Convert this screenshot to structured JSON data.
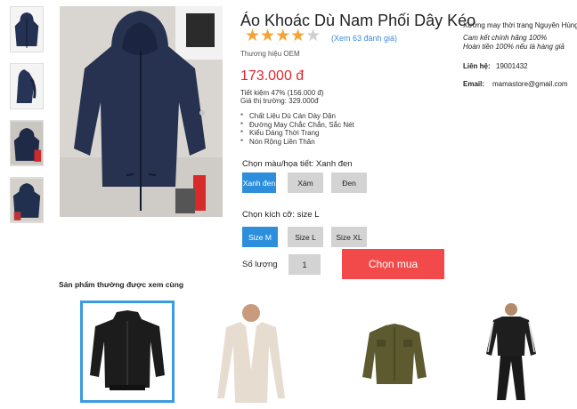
{
  "product": {
    "title": "Áo Khoác Dù Nam Phối Dây Kéo",
    "rating": 4,
    "rating_max": 5,
    "review_link": "(Xem 63 đánh giá)",
    "brand": "Thương hiệu OEM",
    "price": "173.000 đ",
    "saving": "Tiết kiệm 47% (156.000 đ)",
    "market_price": "Giá thị trường: 329.000đ",
    "features": [
      "Chất Liệu Dù Cán Dày Dặn",
      "Đường May Chắc Chắn, Sắc Nét",
      "Kiểu Dáng Thời Trang",
      "Nón Rộng Liền Thân"
    ]
  },
  "color": {
    "label": "Chọn màu/họa tiết: Xanh đen",
    "options": [
      "Xanh đen",
      "Xám",
      "Đen"
    ],
    "selected": 0
  },
  "size": {
    "label": "Chọn kích cỡ: size L",
    "options": [
      "Size M",
      "Size L",
      "Size XL"
    ],
    "selected": 0
  },
  "quantity": {
    "label": "Số lượng",
    "value": "1"
  },
  "buy_button": "Chọn mua",
  "seller": {
    "name": "Xưởng may thời trang Nguyên Hùng",
    "guarantee_1": "Cam kết chính hãng 100%",
    "guarantee_2": "Hoàn tiền 100% nếu là hàng giả",
    "contact_label": "Liên hệ:",
    "contact_value": "19001432",
    "email_label": "Email:",
    "email_value": "mamastore@gmail.com"
  },
  "related": {
    "title": "Sản phẩm thường được xem cùng",
    "selected": 0
  },
  "colors": {
    "accent_blue": "#2d8fdb",
    "price_red": "#e8242c",
    "buy_red": "#f24a4a",
    "star": "#f5a334"
  }
}
